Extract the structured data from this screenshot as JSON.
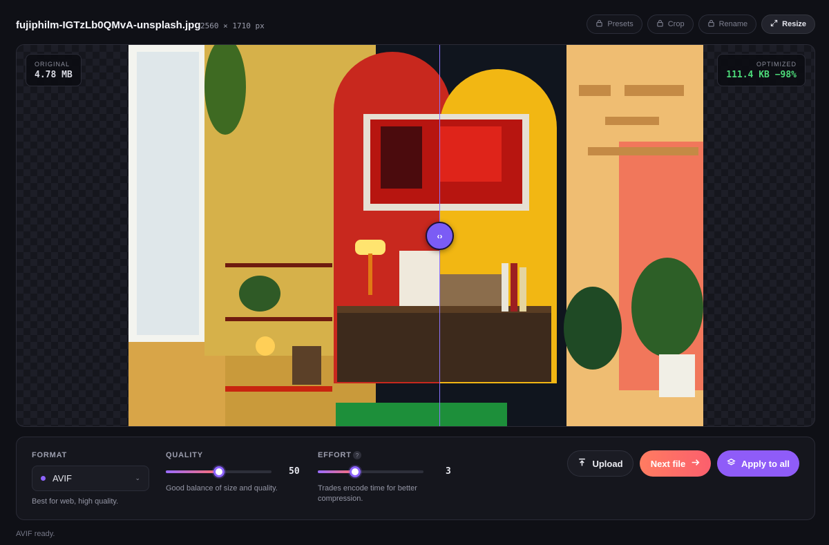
{
  "header": {
    "file_name": "fujiphilm-IGTzLb0QMvA-unsplash.jpg",
    "dimensions": "2560 × 1710 px",
    "toolbar": [
      {
        "label": "Presets",
        "icon": "lock-icon",
        "active": false
      },
      {
        "label": "Crop",
        "icon": "lock-icon",
        "active": false
      },
      {
        "label": "Rename",
        "icon": "lock-icon",
        "active": false
      },
      {
        "label": "Resize",
        "icon": "expand-icon",
        "active": true
      }
    ]
  },
  "viewer": {
    "original_label": "ORIGINAL",
    "original_size": "4.78 MB",
    "optimized_label": "OPTIMIZED",
    "optimized_size": "111.4 KB −98%",
    "handle_glyph": "‹›",
    "compare_position": 0.54
  },
  "controls": {
    "format": {
      "label": "FORMAT",
      "value": "AVIF",
      "hint": "Best for web, high quality.",
      "accent": "#8e64ff"
    },
    "quality": {
      "label": "QUALITY",
      "value": "50",
      "level": 0.5,
      "hint": "Good balance of size and quality."
    },
    "effort": {
      "label": "EFFORT",
      "info": "?",
      "value": "3",
      "level": 0.35,
      "hint_line1": "Trades encode time for better",
      "hint_line2": "compression."
    }
  },
  "actions": {
    "upload": "Upload",
    "next_file": "Next file",
    "apply_all": "Apply to all"
  },
  "status": "AVIF ready.",
  "colors": {
    "accent": "#8e5cf8",
    "next_button": "#fb5f6d",
    "savings": "#4ddc7a"
  }
}
